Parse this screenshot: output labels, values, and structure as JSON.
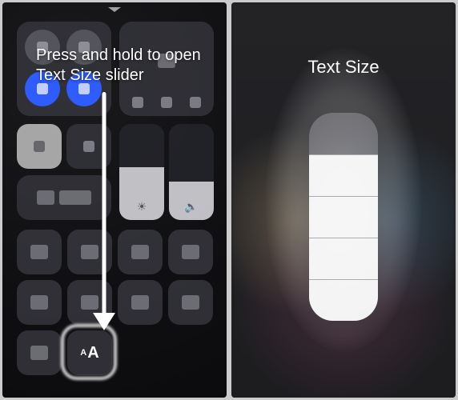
{
  "annotation": {
    "text": "Press and hold to open Text Size slider"
  },
  "left": {
    "text_size_tile": {
      "small": "A",
      "big": "A",
      "name": "text-size"
    },
    "grid_icons": [
      "flashlight-icon",
      "timer-icon",
      "calculator-icon",
      "camera-icon",
      "home-icon",
      "apple-tv-remote-icon",
      "accessibility-icon",
      "notes-icon",
      "stopwatch-icon"
    ]
  },
  "right": {
    "title": "Text Size",
    "slider": {
      "steps": 6,
      "filled_steps": 5,
      "fill_percent": 80
    }
  }
}
